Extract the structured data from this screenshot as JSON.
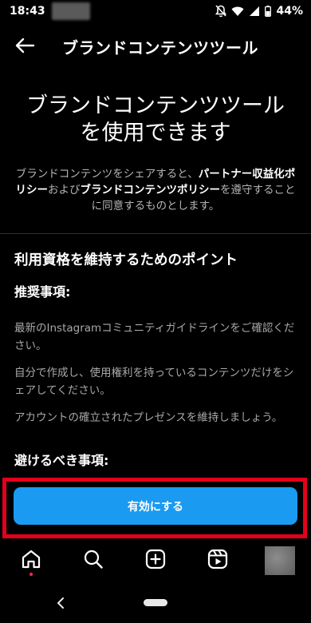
{
  "status_bar": {
    "time": "18:43",
    "battery": "44%"
  },
  "header": {
    "title": "ブランドコンテンツツール"
  },
  "main": {
    "title_line1": "ブランドコンテンツツール",
    "title_line2": "を使用できます",
    "description": {
      "part1": "ブランドコンテンツをシェアすると、",
      "link1": "パートナー収益化ポリシー",
      "part2": "および",
      "link2": "ブランドコンテンツポリシー",
      "part3": "を遵守することに同意するものとします。"
    },
    "section_title": "利用資格を維持するためのポイント",
    "recommended_heading": "推奨事項:",
    "recommended_items": [
      "最新のInstagramコミュニティガイドラインをご確認ください。",
      "自分で作成し、使用権利を持っているコンテンツだけをシェアしてください。",
      "アカウントの確立されたプレゼンスを維持しましょう。"
    ],
    "avoid_heading": "避けるべき事項:",
    "enable_button": "有効にする"
  },
  "tab_bar": {
    "icons": [
      "home-icon",
      "search-icon",
      "create-icon",
      "reels-icon",
      "profile-avatar"
    ]
  },
  "colors": {
    "primary_button": "#1a9af0",
    "highlight_border": "#e4001c",
    "active_dot": "#ff2a4f"
  }
}
